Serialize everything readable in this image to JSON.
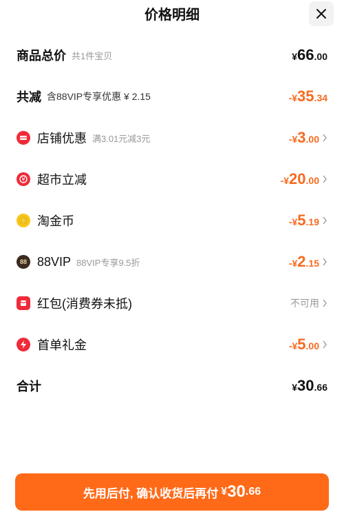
{
  "header": {
    "title": "价格明细",
    "close_icon": "close-icon"
  },
  "rows": {
    "total_goods": {
      "label": "商品总价",
      "sub": "共1件宝贝",
      "prefix": "¥",
      "int": "66",
      "dec": ".00"
    },
    "total_reduce": {
      "label": "共减",
      "sub": "含88VIP专享优惠 ¥ 2.15",
      "prefix": "-¥",
      "int": "35",
      "dec": ".34"
    },
    "shop_discount": {
      "label": "店铺优惠",
      "sub": "满3.01元减3元",
      "prefix": "-¥",
      "int": "3",
      "dec": ".00",
      "icon": "store-coupon-icon",
      "color": "#ef2b3a"
    },
    "market_reduce": {
      "label": "超市立减",
      "prefix": "-¥",
      "int": "20",
      "dec": ".00",
      "icon": "supermarket-icon",
      "color": "#ef2b3a"
    },
    "tao_coin": {
      "label": "淘金币",
      "prefix": "-¥",
      "int": "5",
      "dec": ".19",
      "icon": "coin-icon",
      "color": "#f7c61b"
    },
    "vip88": {
      "label": "88VIP",
      "sub": "88VIP专享9.5折",
      "prefix": "-¥",
      "int": "2",
      "dec": ".15",
      "icon": "vip-88-icon",
      "icon_text": "88",
      "color": "#3a2a20"
    },
    "red_packet": {
      "label": "红包(消费券未抵)",
      "status": "不可用",
      "icon": "red-packet-icon",
      "color": "#ef2b3a"
    },
    "first_gift": {
      "label": "首单礼金",
      "prefix": "-¥",
      "int": "5",
      "dec": ".00",
      "icon": "lightning-icon",
      "color": "#ef2b3a"
    },
    "sum": {
      "label": "合计",
      "prefix": "¥",
      "int": "30",
      "dec": ".66"
    }
  },
  "pay_button": {
    "text": "先用后付, 确认收货后再付",
    "prefix": "¥",
    "int": "30",
    "dec": ".66"
  },
  "colors": {
    "accent": "#ff6a18",
    "discount": "#f76a1f"
  }
}
